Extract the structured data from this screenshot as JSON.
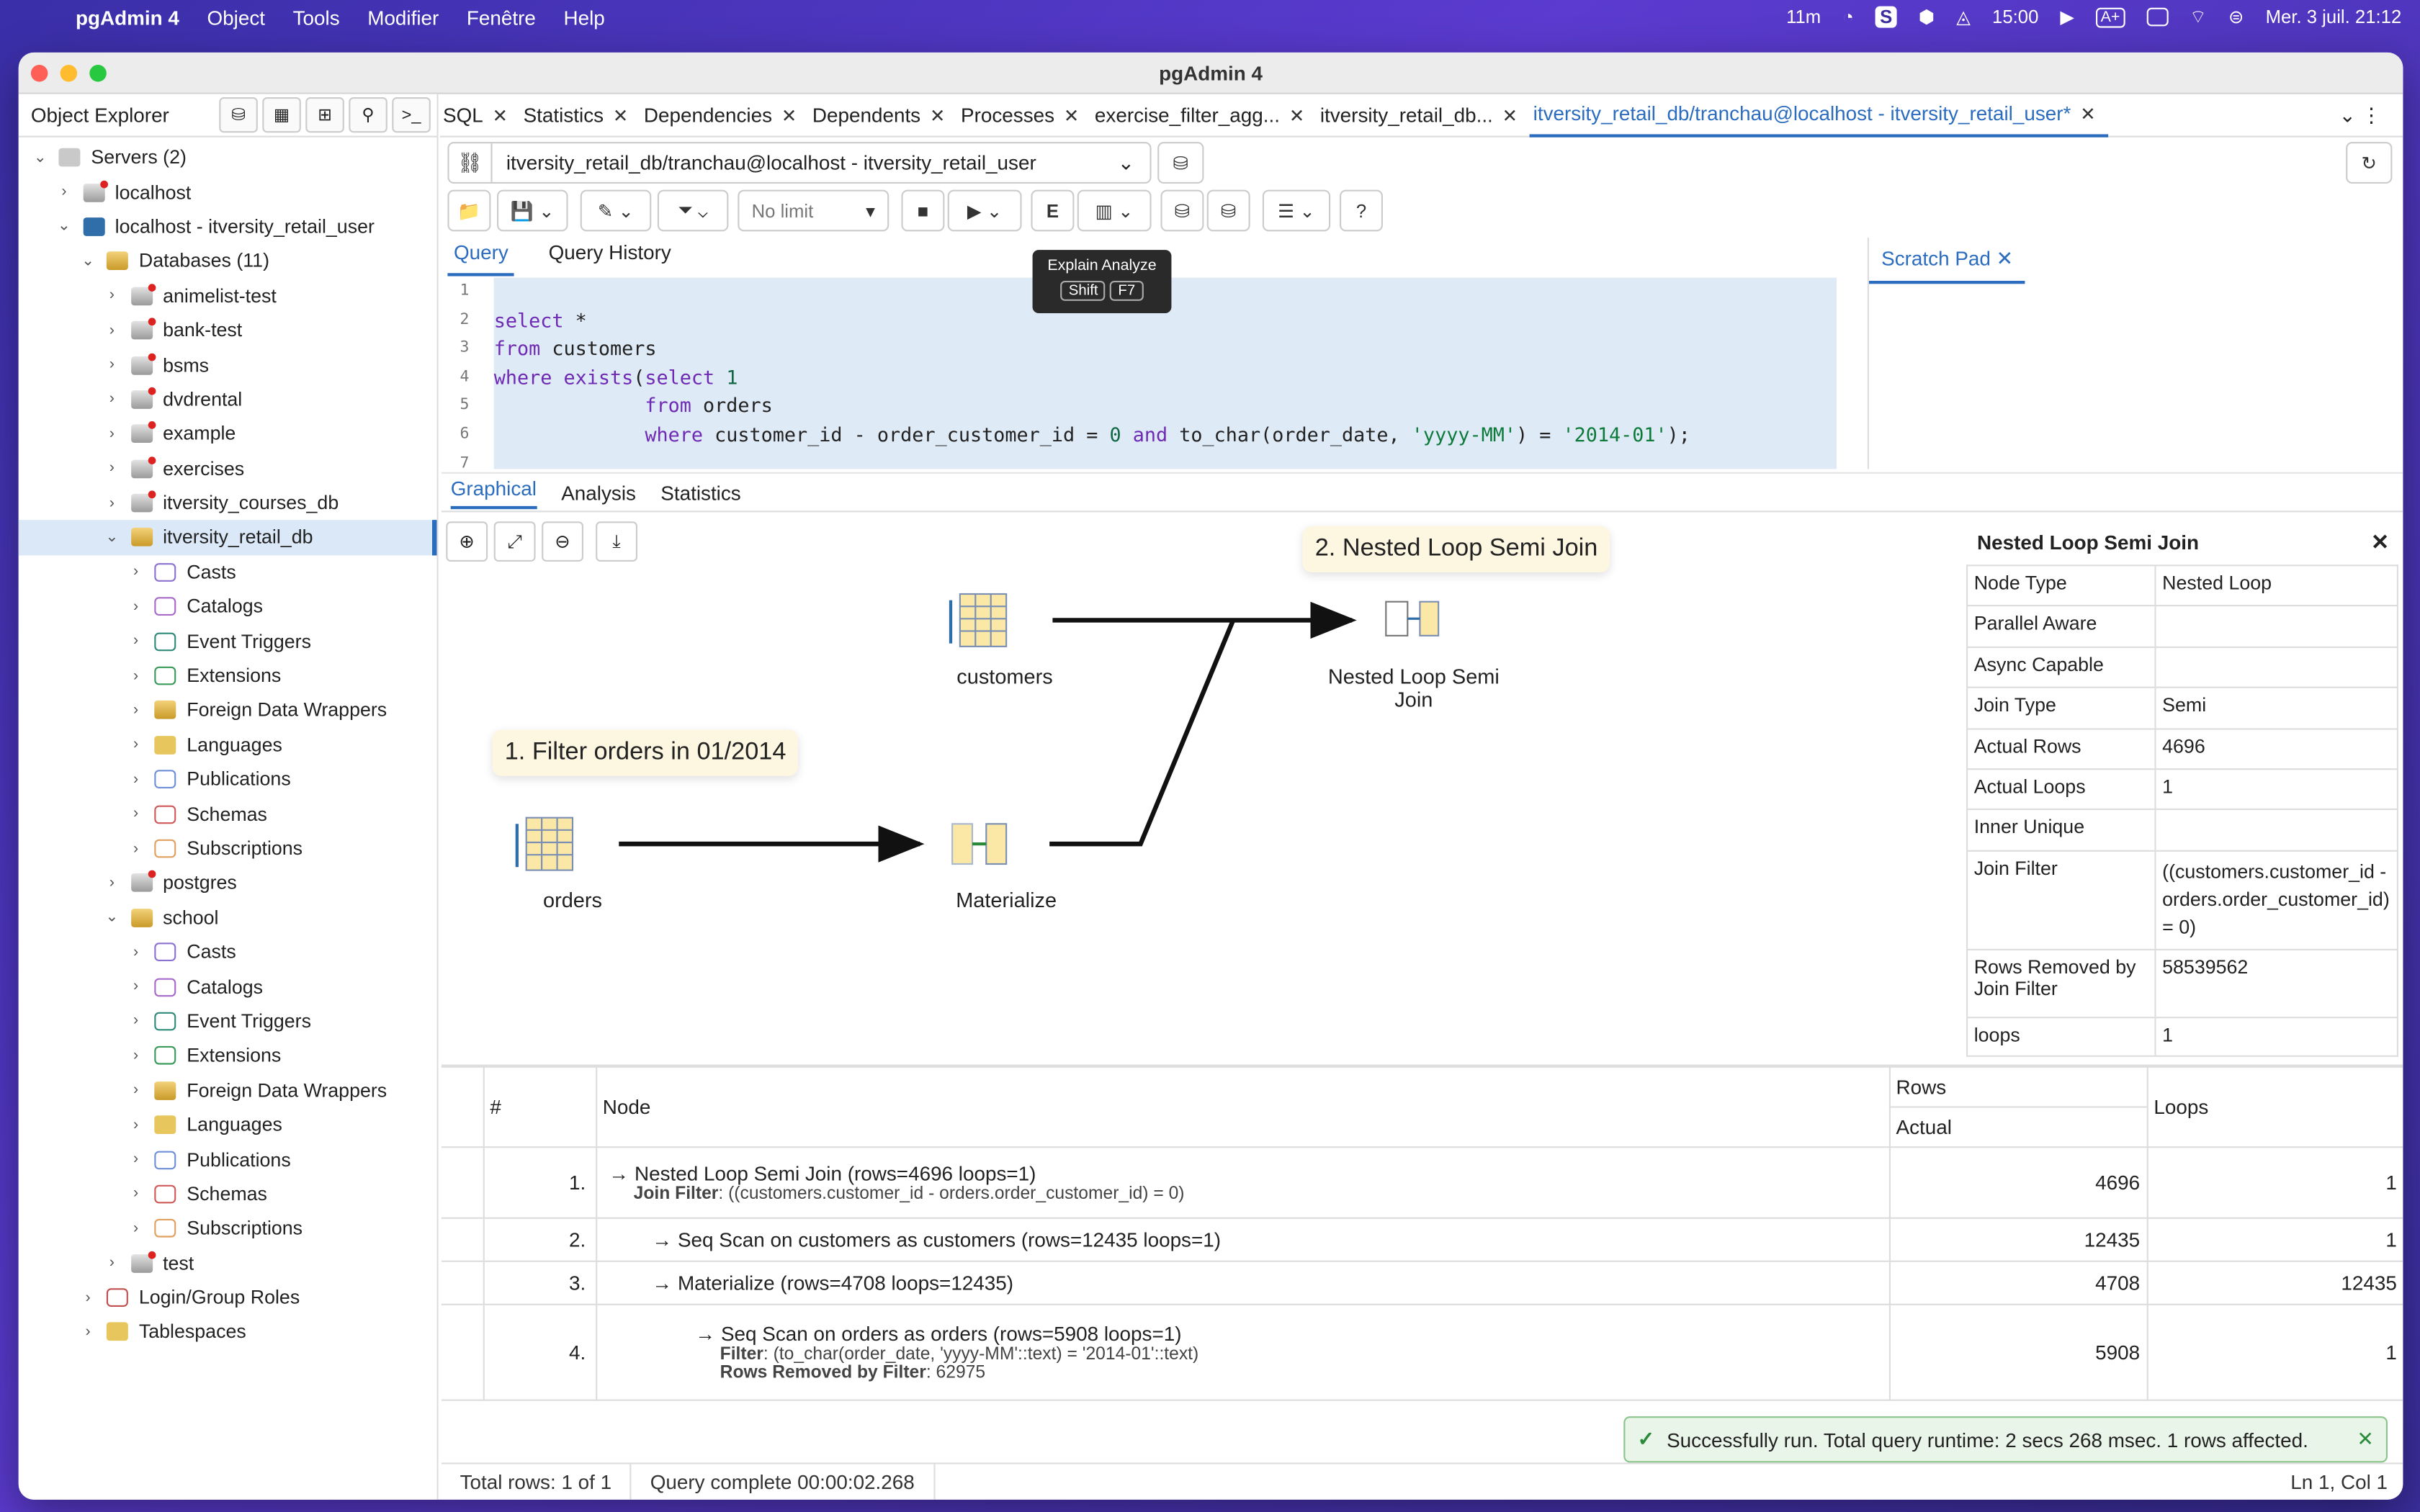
{
  "menubar": {
    "app": "pgAdmin 4",
    "items": [
      "Object",
      "Tools",
      "Modifier",
      "Fenêtre",
      "Help"
    ],
    "status": {
      "timer": "11m",
      "clock": "15:00",
      "datetime": "Mer. 3 juil.  21:12"
    }
  },
  "window": {
    "title": "pgAdmin 4"
  },
  "sidebar": {
    "title": "Object Explorer",
    "tree": [
      {
        "label": "Servers (2)",
        "level": 0,
        "chev": "⌄",
        "icon": "servers"
      },
      {
        "label": "localhost",
        "level": 1,
        "chev": "›",
        "icon": "db-error"
      },
      {
        "label": "localhost - itversity_retail_user",
        "level": 1,
        "chev": "⌄",
        "icon": "postgres"
      },
      {
        "label": "Databases (11)",
        "level": 2,
        "chev": "⌄",
        "icon": "databases"
      },
      {
        "label": "animelist-test",
        "level": 3,
        "chev": "›",
        "icon": "db-error"
      },
      {
        "label": "bank-test",
        "level": 3,
        "chev": "›",
        "icon": "db-error"
      },
      {
        "label": "bsms",
        "level": 3,
        "chev": "›",
        "icon": "db-error"
      },
      {
        "label": "dvdrental",
        "level": 3,
        "chev": "›",
        "icon": "db-error"
      },
      {
        "label": "example",
        "level": 3,
        "chev": "›",
        "icon": "db-error"
      },
      {
        "label": "exercises",
        "level": 3,
        "chev": "›",
        "icon": "db-error"
      },
      {
        "label": "itversity_courses_db",
        "level": 3,
        "chev": "›",
        "icon": "db-error"
      },
      {
        "label": "itversity_retail_db",
        "level": 3,
        "chev": "⌄",
        "icon": "db-connected",
        "selected": true
      },
      {
        "label": "Casts",
        "level": 4,
        "chev": "›",
        "icon": "casts"
      },
      {
        "label": "Catalogs",
        "level": 4,
        "chev": "›",
        "icon": "catalogs"
      },
      {
        "label": "Event Triggers",
        "level": 4,
        "chev": "›",
        "icon": "event-triggers"
      },
      {
        "label": "Extensions",
        "level": 4,
        "chev": "›",
        "icon": "extensions"
      },
      {
        "label": "Foreign Data Wrappers",
        "level": 4,
        "chev": "›",
        "icon": "fdw"
      },
      {
        "label": "Languages",
        "level": 4,
        "chev": "›",
        "icon": "languages"
      },
      {
        "label": "Publications",
        "level": 4,
        "chev": "›",
        "icon": "publications"
      },
      {
        "label": "Schemas",
        "level": 4,
        "chev": "›",
        "icon": "schemas"
      },
      {
        "label": "Subscriptions",
        "level": 4,
        "chev": "›",
        "icon": "subscriptions"
      },
      {
        "label": "postgres",
        "level": 3,
        "chev": "›",
        "icon": "db-error"
      },
      {
        "label": "school",
        "level": 3,
        "chev": "⌄",
        "icon": "db-connected"
      },
      {
        "label": "Casts",
        "level": 4,
        "chev": "›",
        "icon": "casts"
      },
      {
        "label": "Catalogs",
        "level": 4,
        "chev": "›",
        "icon": "catalogs"
      },
      {
        "label": "Event Triggers",
        "level": 4,
        "chev": "›",
        "icon": "event-triggers"
      },
      {
        "label": "Extensions",
        "level": 4,
        "chev": "›",
        "icon": "extensions"
      },
      {
        "label": "Foreign Data Wrappers",
        "level": 4,
        "chev": "›",
        "icon": "fdw"
      },
      {
        "label": "Languages",
        "level": 4,
        "chev": "›",
        "icon": "languages"
      },
      {
        "label": "Publications",
        "level": 4,
        "chev": "›",
        "icon": "publications"
      },
      {
        "label": "Schemas",
        "level": 4,
        "chev": "›",
        "icon": "schemas"
      },
      {
        "label": "Subscriptions",
        "level": 4,
        "chev": "›",
        "icon": "subscriptions"
      },
      {
        "label": "test",
        "level": 3,
        "chev": "›",
        "icon": "db-error"
      },
      {
        "label": "Login/Group Roles",
        "level": 2,
        "chev": "›",
        "icon": "roles"
      },
      {
        "label": "Tablespaces",
        "level": 2,
        "chev": "›",
        "icon": "tablespaces"
      }
    ]
  },
  "tabs": [
    {
      "label": "SQL"
    },
    {
      "label": "Statistics"
    },
    {
      "label": "Dependencies"
    },
    {
      "label": "Dependents"
    },
    {
      "label": "Processes"
    },
    {
      "label": "exercise_filter_agg..."
    },
    {
      "label": "itversity_retail_db..."
    },
    {
      "label": "itversity_retail_db/tranchau@localhost - itversity_retail_user*",
      "active": true
    }
  ],
  "connection": {
    "label": "itversity_retail_db/tranchau@localhost - itversity_retail_user"
  },
  "toolbar": {
    "limit": "No limit",
    "explain_label": "E"
  },
  "tooltip": {
    "title": "Explain Analyze",
    "key1": "Shift",
    "key2": "F7"
  },
  "query_tabs": {
    "query": "Query",
    "history": "Query History",
    "scratch": "Scratch Pad"
  },
  "editor": {
    "line_numbers": [
      "1",
      "2",
      "3",
      "4",
      "5",
      "6",
      "7"
    ]
  },
  "result_tabs": {
    "graphical": "Graphical",
    "analysis": "Analysis",
    "statistics": "Statistics"
  },
  "graph": {
    "customers": "customers",
    "orders": "orders",
    "materialize": "Materialize",
    "nested": "Nested Loop Semi Join",
    "callout1": "1. Filter orders in 01/2014",
    "callout2": "2. Nested Loop Semi Join"
  },
  "props": {
    "title": "Nested Loop Semi Join",
    "rows": [
      {
        "k": "Node Type",
        "v": "Nested Loop"
      },
      {
        "k": "Parallel Aware",
        "v": ""
      },
      {
        "k": "Async Capable",
        "v": ""
      },
      {
        "k": "Join Type",
        "v": "Semi"
      },
      {
        "k": "Actual Rows",
        "v": "4696"
      },
      {
        "k": "Actual Loops",
        "v": "1"
      },
      {
        "k": "Inner Unique",
        "v": ""
      },
      {
        "k": "Join Filter",
        "v": "((customers.customer_id - orders.order_customer_id) = 0)"
      },
      {
        "k": "Rows Removed by Join Filter",
        "v": "58539562"
      },
      {
        "k": "loops",
        "v": "1"
      }
    ]
  },
  "results": {
    "h_num": "#",
    "h_node": "Node",
    "h_rows": "Rows",
    "h_actual": "Actual",
    "h_loops": "Loops",
    "rows": [
      {
        "n": "1.",
        "node": "→ Nested Loop Semi Join (rows=4696 loops=1)",
        "detail_k": "Join Filter",
        "detail_v": ": ((customers.customer_id - orders.order_customer_id) = 0)",
        "rows": "4696",
        "loops": "1"
      },
      {
        "n": "2.",
        "node": "→ Seq Scan on customers as customers (rows=12435 loops=1)",
        "rows": "12435",
        "loops": "1"
      },
      {
        "n": "3.",
        "node": "→ Materialize (rows=4708 loops=12435)",
        "rows": "4708",
        "loops": "12435"
      },
      {
        "n": "4.",
        "node": "→ Seq Scan on orders as orders (rows=5908 loops=1)",
        "detail_k": "Filter",
        "detail_v": ": (to_char(order_date, 'yyyy-MM'::text) = '2014-01'::text)",
        "detail2_k": "Rows Removed by Filter",
        "detail2_v": ": 62975",
        "rows": "5908",
        "loops": "1"
      }
    ]
  },
  "toast": "Successfully run. Total query runtime: 2 secs 268 msec. 1 rows affected.",
  "status": {
    "total": "Total rows: 1 of 1",
    "complete": "Query complete 00:00:02.268",
    "pos": "Ln 1, Col 1"
  },
  "colors": {
    "accent": "#2b6cbf",
    "selection": "#dbe8f8",
    "success": "#eaf5ea"
  }
}
